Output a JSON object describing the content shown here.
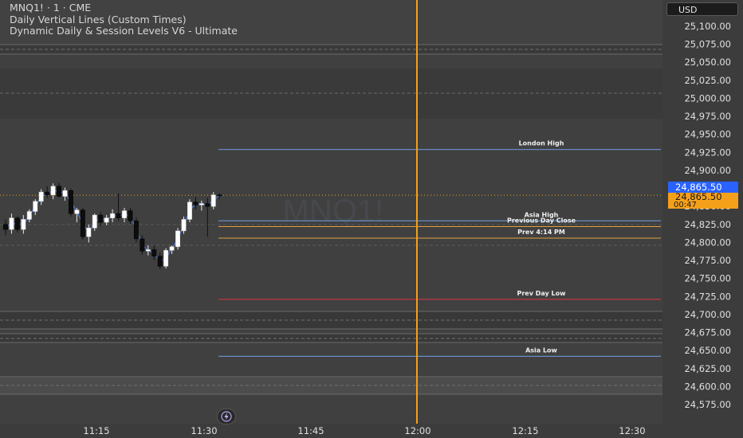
{
  "header": {
    "symbol_line": "MNQ1! · 1 · CME",
    "indicator_1": "Daily Vertical Lines (Custom Times)",
    "indicator_2": "Dynamic Daily & Session Levels V6 - Ultimate"
  },
  "currency_button": "USD",
  "watermark": "MNQ1!",
  "price_axis": {
    "ticks": [
      "25,100.00",
      "25,075.00",
      "25,050.00",
      "25,025.00",
      "25,000.00",
      "24,975.00",
      "24,950.00",
      "24,925.00",
      "24,900.00",
      "24,875.00",
      "24,850.00",
      "24,825.00",
      "24,800.00",
      "24,775.00",
      "24,750.00",
      "24,725.00",
      "24,700.00",
      "24,675.00",
      "24,650.00",
      "24,625.00",
      "24,600.00",
      "24,575.00"
    ],
    "last_price": "24,865.50",
    "countdown": "00:47",
    "accent_last": "#2962ff",
    "accent_countdown": "#f5a01a"
  },
  "time_axis": {
    "ticks": [
      "11:15",
      "11:30",
      "11:45",
      "12:00",
      "12:15",
      "12:30"
    ]
  },
  "level_labels": {
    "london_high": "London High",
    "asia_high": "Asia High",
    "prev_day_close": "Previous Day Close",
    "prev_414": "Prev 4:14 PM",
    "prev_day_low": "Prev Day Low",
    "asia_low": "Asia Low"
  },
  "icons": {
    "bolt": "lightning-icon"
  },
  "colors": {
    "vertical_line": "#f5a01a",
    "blue_level": "#6fa0e0",
    "red_level": "#e0344a",
    "orange_level": "#e0a040"
  },
  "chart_data": {
    "type": "candlestick",
    "symbol": "MNQ1!",
    "timeframe": "1",
    "y_range": [
      24565,
      25110
    ],
    "x_ticks": [
      "11:15",
      "11:30",
      "11:45",
      "12:00",
      "12:15",
      "12:30"
    ],
    "vertical_line_time": "12:00",
    "last_price": 24865.5,
    "levels": [
      {
        "label": "London High",
        "price": 24929
      },
      {
        "label": "Asia High",
        "price": 24830
      },
      {
        "label": "Previous Day Close",
        "price": 24822
      },
      {
        "label": "Prev 4:14 PM",
        "price": 24806
      },
      {
        "label": "Prev Day Low",
        "price": 24721
      },
      {
        "label": "Asia Low",
        "price": 24642
      }
    ],
    "candles": [
      {
        "t": "11:03",
        "o": 24825,
        "h": 24832,
        "l": 24810,
        "c": 24818
      },
      {
        "t": "11:04",
        "o": 24818,
        "h": 24840,
        "l": 24812,
        "c": 24834
      },
      {
        "t": "11:05",
        "o": 24834,
        "h": 24836,
        "l": 24814,
        "c": 24818
      },
      {
        "t": "11:06",
        "o": 24818,
        "h": 24838,
        "l": 24812,
        "c": 24832
      },
      {
        "t": "11:07",
        "o": 24832,
        "h": 24846,
        "l": 24828,
        "c": 24843
      },
      {
        "t": "11:08",
        "o": 24843,
        "h": 24860,
        "l": 24838,
        "c": 24857
      },
      {
        "t": "11:09",
        "o": 24857,
        "h": 24874,
        "l": 24852,
        "c": 24870
      },
      {
        "t": "11:10",
        "o": 24870,
        "h": 24878,
        "l": 24862,
        "c": 24866
      },
      {
        "t": "11:11",
        "o": 24866,
        "h": 24882,
        "l": 24860,
        "c": 24878
      },
      {
        "t": "11:12",
        "o": 24878,
        "h": 24883,
        "l": 24862,
        "c": 24864
      },
      {
        "t": "11:13",
        "o": 24864,
        "h": 24876,
        "l": 24858,
        "c": 24872
      },
      {
        "t": "11:14",
        "o": 24872,
        "h": 24875,
        "l": 24836,
        "c": 24840
      },
      {
        "t": "11:15",
        "o": 24840,
        "h": 24848,
        "l": 24828,
        "c": 24845
      },
      {
        "t": "11:16",
        "o": 24845,
        "h": 24848,
        "l": 24804,
        "c": 24808
      },
      {
        "t": "11:17",
        "o": 24808,
        "h": 24825,
        "l": 24800,
        "c": 24820
      },
      {
        "t": "11:18",
        "o": 24820,
        "h": 24840,
        "l": 24816,
        "c": 24838
      },
      {
        "t": "11:19",
        "o": 24838,
        "h": 24842,
        "l": 24822,
        "c": 24828
      },
      {
        "t": "11:20",
        "o": 24828,
        "h": 24838,
        "l": 24824,
        "c": 24834
      },
      {
        "t": "11:21",
        "o": 24834,
        "h": 24846,
        "l": 24828,
        "c": 24840
      },
      {
        "t": "11:22",
        "o": 24840,
        "h": 24868,
        "l": 24830,
        "c": 24834
      },
      {
        "t": "11:23",
        "o": 24834,
        "h": 24848,
        "l": 24828,
        "c": 24844
      },
      {
        "t": "11:24",
        "o": 24844,
        "h": 24848,
        "l": 24826,
        "c": 24830
      },
      {
        "t": "11:25",
        "o": 24830,
        "h": 24835,
        "l": 24800,
        "c": 24805
      },
      {
        "t": "11:26",
        "o": 24805,
        "h": 24810,
        "l": 24783,
        "c": 24788
      },
      {
        "t": "11:27",
        "o": 24788,
        "h": 24796,
        "l": 24782,
        "c": 24790
      },
      {
        "t": "11:28",
        "o": 24790,
        "h": 24796,
        "l": 24776,
        "c": 24781
      },
      {
        "t": "11:29",
        "o": 24781,
        "h": 24786,
        "l": 24763,
        "c": 24767
      },
      {
        "t": "11:30",
        "o": 24767,
        "h": 24792,
        "l": 24764,
        "c": 24789
      },
      {
        "t": "11:31",
        "o": 24789,
        "h": 24796,
        "l": 24784,
        "c": 24794
      },
      {
        "t": "11:32",
        "o": 24794,
        "h": 24820,
        "l": 24790,
        "c": 24816
      },
      {
        "t": "11:33",
        "o": 24816,
        "h": 24836,
        "l": 24812,
        "c": 24832
      },
      {
        "t": "11:34",
        "o": 24832,
        "h": 24860,
        "l": 24828,
        "c": 24856
      },
      {
        "t": "11:35",
        "o": 24856,
        "h": 24863,
        "l": 24846,
        "c": 24852
      },
      {
        "t": "11:36",
        "o": 24852,
        "h": 24858,
        "l": 24844,
        "c": 24854
      },
      {
        "t": "11:37",
        "o": 24854,
        "h": 24862,
        "l": 24808,
        "c": 24850
      },
      {
        "t": "11:38",
        "o": 24850,
        "h": 24870,
        "l": 24846,
        "c": 24866
      },
      {
        "t": "11:39",
        "o": 24866,
        "h": 24868,
        "l": 24860,
        "c": 24865.5
      }
    ]
  }
}
